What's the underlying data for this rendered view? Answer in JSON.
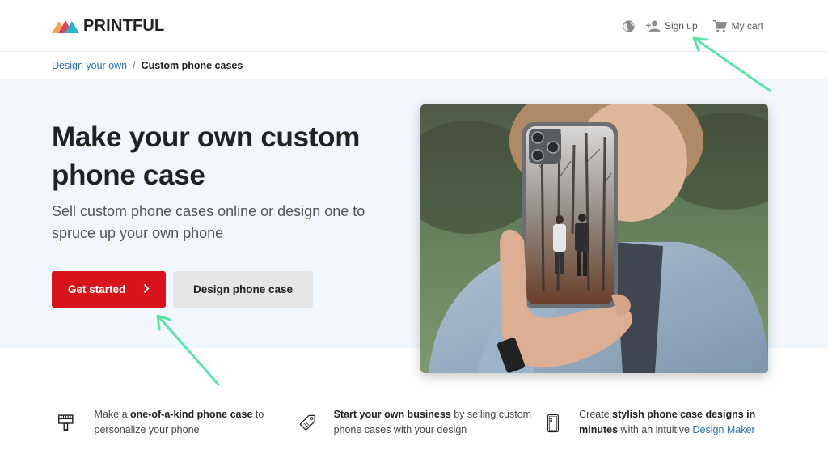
{
  "header": {
    "logo_text": "PRINTFUL",
    "signup_label": "Sign up",
    "cart_label": "My cart",
    "icons": [
      "globe-icon",
      "add-user-icon",
      "cart-icon"
    ]
  },
  "breadcrumb": {
    "parent": "Design your own",
    "separator": "/",
    "current": "Custom phone cases"
  },
  "hero": {
    "title": "Make your own custom phone case",
    "subtitle": "Sell custom phone cases online or design one to spruce up your own phone",
    "primary_button": "Get started",
    "secondary_button": "Design phone case"
  },
  "features": [
    {
      "icon": "brush-icon",
      "pre": "Make a ",
      "bold": "one-of-a-kind phone case",
      "post": " to personalize your phone"
    },
    {
      "icon": "price-tag-icon",
      "bold": "Start your own business",
      "post": " by selling custom phone cases with your design"
    },
    {
      "icon": "phone-case-icon",
      "pre": "Create ",
      "bold": "stylish phone case designs in minutes",
      "mid": " with an intuitive ",
      "link": "Design Maker"
    }
  ],
  "colors": {
    "brand_red": "#d9131b",
    "link_blue": "#2a6fb0",
    "hero_bg": "#f1f7fc",
    "annotation_arrow": "#5de3a8"
  }
}
